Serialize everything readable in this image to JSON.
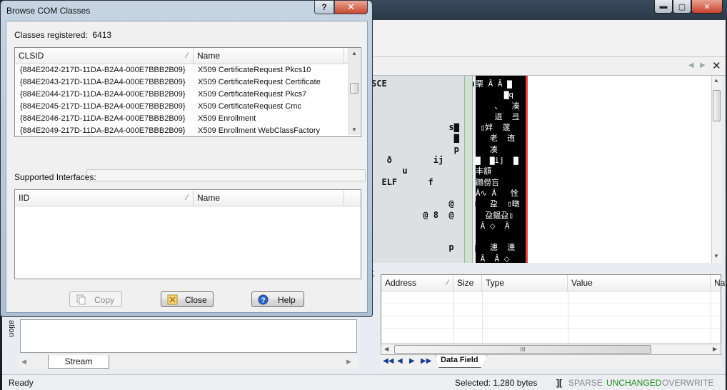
{
  "dialog": {
    "title": "Browse COM Classes",
    "help_glyph": "?",
    "close_glyph": "✕",
    "classes_registered_label": "Classes registered:",
    "classes_registered_count": "6413",
    "clsid_list": {
      "columns": [
        "CLSID",
        "Name"
      ],
      "rows": [
        {
          "clsid": "{884E2042-217D-11DA-B2A4-000E7BBB2B09}",
          "name": "X509 CertificateRequest Pkcs10"
        },
        {
          "clsid": "{884E2043-217D-11DA-B2A4-000E7BBB2B09}",
          "name": "X509 CertificateRequest Certificate"
        },
        {
          "clsid": "{884E2044-217D-11DA-B2A4-000E7BBB2B09}",
          "name": "X509 CertificateRequest Pkcs7"
        },
        {
          "clsid": "{884E2045-217D-11DA-B2A4-000E7BBB2B09}",
          "name": "X509 CertificateRequest Cmc"
        },
        {
          "clsid": "{884E2046-217D-11DA-B2A4-000E7BBB2B09}",
          "name": "X509 Enrollment"
        },
        {
          "clsid": "{884E2049-217D-11DA-B2A4-000E7BBB2B09}",
          "name": "X509 Enrollment WebClassFactory"
        }
      ]
    },
    "supported_interfaces_label": "Supported Interfaces:",
    "interfaces_list": {
      "columns": [
        "IID",
        "Name"
      ]
    },
    "buttons": {
      "copy": "Copy",
      "close": "Close",
      "help": "Help"
    },
    "icons": {
      "copy": "copy-icon",
      "close": "close-icon",
      "help": "help-icon"
    }
  },
  "main": {
    "window_controls": {
      "minimize": "▬",
      "maximize": "▢",
      "close": "✕"
    },
    "doc_close": "✕",
    "doc_nav_prev": "◀",
    "doc_nav_next": "▶",
    "hex_ascii_a": "SCE                à\n                  q\n                  p\n                  Ð\n               s▇ @\n                ▇\n                p\n   ð        ij\n      u\n  ELF      f\n                   `\n               @    n▇\n          @ 8  @\n\n\n               p    p",
    "hex_black": "栗 Â Â ▇\n      ▇q\n    、  凑\n    退  弖\n ▯姅  蓫\n   老  迶\n   凑\n▇  ▇ij  ▇\n丰額\n鸊僗吂\nÂ∿ Â   恮\n   盁  ▯暾\n  盁鎾盁▯\n Â ⬦  Â\n\n   漶  漶\n Â  Â ⬦",
    "data_fields": {
      "columns": [
        "Address",
        "Size",
        "Type",
        "Value",
        "Na"
      ],
      "tabs": [
        "Data Field"
      ],
      "nav_glyphs": [
        "◀◀",
        "◀",
        "▶",
        "▶▶"
      ],
      "hscroll_thumb_glyph": "III"
    },
    "stream": {
      "side_label": "ation",
      "tab_label": "Stream"
    },
    "splitter_glyph": "K",
    "status": {
      "ready": "Ready",
      "selected": "Selected: 1,280 bytes",
      "sep": "][",
      "sparse": "SPARSE",
      "unchanged": "UNCHANGED",
      "overwrite": "OVERWRITE"
    },
    "colors": {
      "unchanged": "#1e8e1e",
      "inactive_flag": "#8a8a8a",
      "close_button": "#c8462e"
    }
  }
}
